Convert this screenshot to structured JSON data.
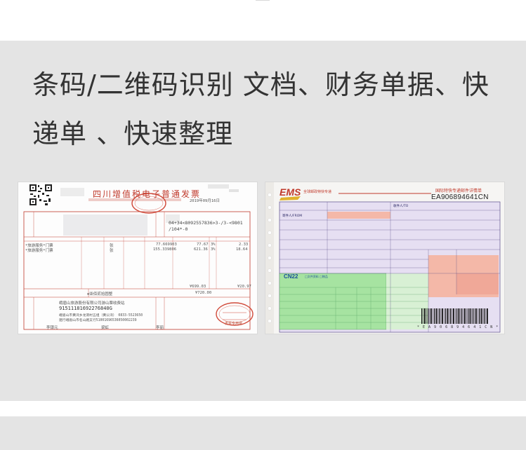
{
  "headline": {
    "line1": "条码/二维码识别 文档、财务单据、快",
    "line2": "递单 、快速整理"
  },
  "invoice": {
    "title": "四川增值税电子普通发票",
    "date": "2019年09月16日",
    "code_partial": "04+34<8092557836>3-/3-<9801",
    "code_partial2": "/104*-0",
    "item1": "*旅游服务*门票",
    "item2": "*旅游服务*门票",
    "unit1": "张",
    "unit2": "张",
    "price1": "77.669903",
    "price2": "155.339806",
    "amt1": "77.67",
    "amt2": "621.36",
    "tax_rate1": "3%",
    "tax_rate2": "3%",
    "tax1": "2.33",
    "tax2": "18.64",
    "subtotal": "¥699.03",
    "tax_total": "¥20.97",
    "total_words": "⊗柒佰贰拾圆整",
    "total": "¥720.00",
    "seller": "峨眉山旅游股份有限公司游山票收费站",
    "tax_id": "91511181692276840G",
    "address": "峨眉山市黄湾乡龙洞村五组（黄公湾） 0833-5523650",
    "bank": "建行峨眉山市名山路支行51001696536050002239",
    "payee": "李银元",
    "reviewer": "梁虹",
    "drawer": "李丽",
    "stamp_text": "发票专用章"
  },
  "ems": {
    "brand": "EMS",
    "subtitle": "全球邮政特快专递",
    "header": "国际特快专递邮件详情单",
    "tracking": "EA906894641CN",
    "from_label": "寄件人/FROM",
    "to_label": "收件人/TO",
    "cn22": "CN22",
    "doc_label": "□文件资料 □物品",
    "barcode_label": "* E A 9 0 6 8 9 4 6 4 1 C N *"
  },
  "colors": {
    "panel_bg": "#e4e4e4",
    "headline": "#333333",
    "invoice_red": "#c0392b",
    "ems_blue": "#1a4f9c",
    "ems_green": "#a6e3a1",
    "ems_pink": "#f4b8a8"
  }
}
